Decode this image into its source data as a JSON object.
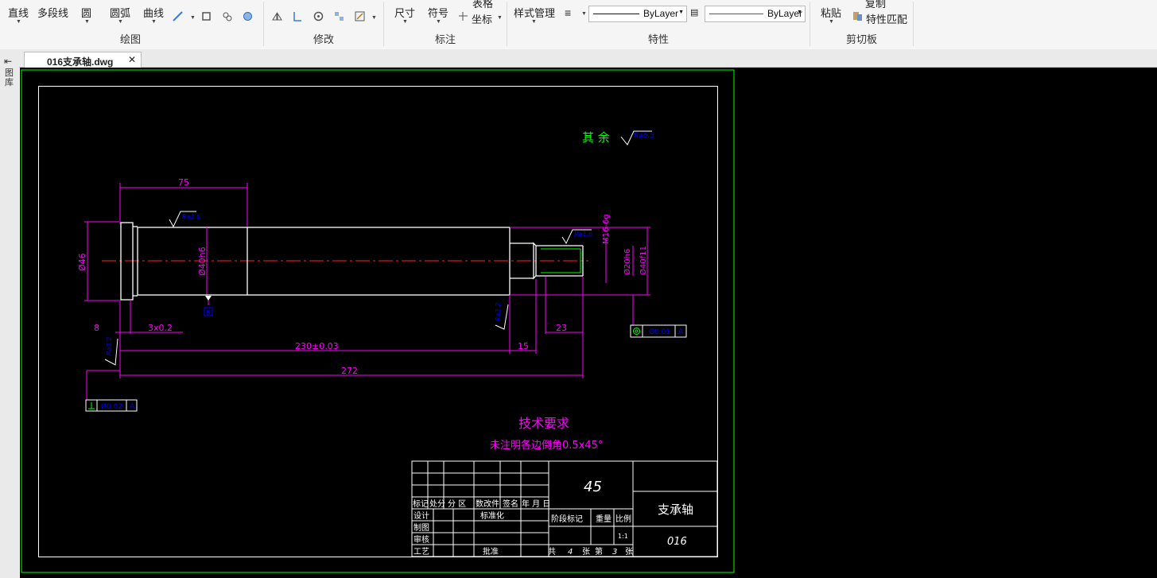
{
  "ribbon": {
    "draw": {
      "line": "直线",
      "polyline": "多段线",
      "circle": "圆",
      "arc": "圆弧",
      "curve": "曲线",
      "group": "绘图"
    },
    "modify": {
      "group": "修改"
    },
    "annotate": {
      "dimension": "尺寸",
      "symbol": "符号",
      "table": "表格",
      "coordinate": "坐标",
      "group": "标注"
    },
    "properties": {
      "style_manager": "样式管理",
      "linetype": "ByLayer",
      "color": "ByLayer",
      "group": "特性"
    },
    "clipboard": {
      "paste": "粘贴",
      "copy": "复制",
      "match_props": "特性匹配",
      "group": "剪切板"
    }
  },
  "tab": {
    "name": "016支承轴.dwg"
  },
  "side_panel_label": "图库",
  "drawing": {
    "roughness_note_label": "其  余",
    "roughness_main": "Ra6.3",
    "roughness_a": "Ra1.6",
    "roughness_b": "Ra1.6",
    "roughness_c": "Ra3.2",
    "roughness_d": "Ra3.2",
    "dim_75": "75",
    "dim_d46": "Ø46",
    "dim_d40h6": "Ø40h6",
    "dim_m16": "M16-6g",
    "dim_d20h6": "Ø20h6",
    "dim_d40f11": "Ø40f11",
    "dim_8": "8",
    "dim_3x02": "3x0.2",
    "dim_23": "23",
    "dim_230": "230±0.03",
    "dim_15": "15",
    "dim_272": "272",
    "datum": "B",
    "tol_coax_value": "Ø0.01",
    "tol_coax_datum": "A",
    "tol_perp_value": "Ø0.02",
    "tol_perp_datum": "A",
    "tech_title": "技术要求",
    "tech_note": "未注明各边倒角0.5x45°",
    "title_block": {
      "material": "45",
      "part_name": "支承轴",
      "drawing_no": "016",
      "row_header": [
        "标记",
        "处分",
        "分 区",
        "数改件",
        "签名",
        "年 月 日"
      ],
      "design": "设计",
      "standardize": "标准化",
      "draft": "制图",
      "review": "审核",
      "process": "工艺",
      "approve": "批准",
      "stage_mark": "阶段标记",
      "weight": "重量",
      "scale": "比例",
      "scale_value": "1:1",
      "sheets_total": "共",
      "sheets_total_n": "4",
      "sheet_word": "张",
      "sheet_no_word": "第",
      "sheet_no": "3",
      "sheet_word2": "张"
    }
  },
  "colors": {
    "dim": "#ff00ff",
    "outline": "#ffffff",
    "center": "#ff2020",
    "note": "#ff00ff",
    "rough_text": "#0000ff",
    "frame_green": "#00ff00",
    "thread": "#00ff00",
    "tol": "#0000ff"
  }
}
